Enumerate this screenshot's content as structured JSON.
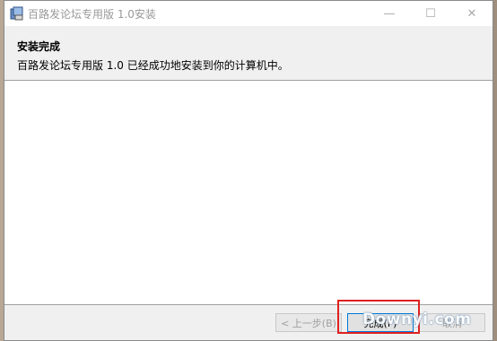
{
  "window": {
    "title": "百路发论坛专用版 1.0安装",
    "minimize_glyph": "—",
    "maximize_glyph": "☐",
    "close_glyph": "✕"
  },
  "header": {
    "title": "安装完成",
    "description": "百路发论坛专用版 1.0 已经成功地安装到你的计算机中。"
  },
  "footer": {
    "back_label": "< 上一步(B)",
    "finish_label": "完成(F)",
    "cancel_label": "取消"
  },
  "overlay": {
    "watermark_text": "Downyi.com"
  },
  "colors": {
    "highlight": "#e02020",
    "focus_border": "#0078d7"
  },
  "icons": {
    "app": "installer-icon"
  }
}
